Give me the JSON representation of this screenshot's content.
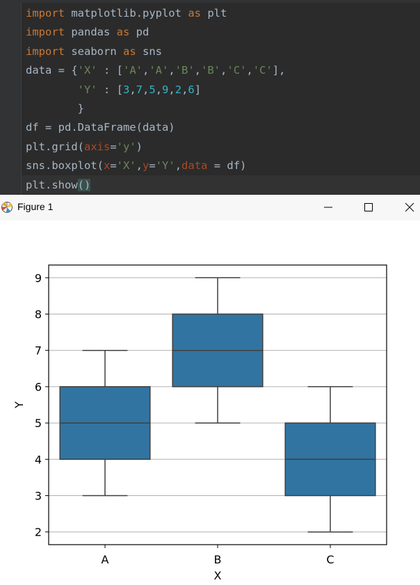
{
  "editor": {
    "lines": [
      [
        {
          "t": "import",
          "c": "kw"
        },
        {
          "t": " matplotlib.pyplot ",
          "c": "plain"
        },
        {
          "t": "as",
          "c": "kw"
        },
        {
          "t": " plt",
          "c": "plain"
        }
      ],
      [
        {
          "t": "import",
          "c": "kw"
        },
        {
          "t": " pandas ",
          "c": "plain"
        },
        {
          "t": "as",
          "c": "kw"
        },
        {
          "t": " pd",
          "c": "plain"
        }
      ],
      [
        {
          "t": "import",
          "c": "kw"
        },
        {
          "t": " seaborn ",
          "c": "plain"
        },
        {
          "t": "as",
          "c": "kw"
        },
        {
          "t": " sns",
          "c": "plain"
        }
      ],
      [
        {
          "t": "data = {",
          "c": "plain"
        },
        {
          "t": "'X'",
          "c": "str"
        },
        {
          "t": " : [",
          "c": "plain"
        },
        {
          "t": "'A'",
          "c": "str"
        },
        {
          "t": ",",
          "c": "plain"
        },
        {
          "t": "'A'",
          "c": "str"
        },
        {
          "t": ",",
          "c": "plain"
        },
        {
          "t": "'B'",
          "c": "str"
        },
        {
          "t": ",",
          "c": "plain"
        },
        {
          "t": "'B'",
          "c": "str"
        },
        {
          "t": ",",
          "c": "plain"
        },
        {
          "t": "'C'",
          "c": "str"
        },
        {
          "t": ",",
          "c": "plain"
        },
        {
          "t": "'C'",
          "c": "str"
        },
        {
          "t": "],",
          "c": "plain"
        }
      ],
      [
        {
          "t": "        ",
          "c": "plain"
        },
        {
          "t": "'Y'",
          "c": "str"
        },
        {
          "t": " : [",
          "c": "plain"
        },
        {
          "t": "3",
          "c": "num"
        },
        {
          "t": ",",
          "c": "plain"
        },
        {
          "t": "7",
          "c": "num"
        },
        {
          "t": ",",
          "c": "plain"
        },
        {
          "t": "5",
          "c": "num"
        },
        {
          "t": ",",
          "c": "plain"
        },
        {
          "t": "9",
          "c": "num"
        },
        {
          "t": ",",
          "c": "plain"
        },
        {
          "t": "2",
          "c": "num"
        },
        {
          "t": ",",
          "c": "plain"
        },
        {
          "t": "6",
          "c": "num"
        },
        {
          "t": "]",
          "c": "plain"
        }
      ],
      [
        {
          "t": "        }",
          "c": "plain"
        }
      ],
      [
        {
          "t": "df = pd.DataFrame(data)",
          "c": "plain"
        }
      ],
      [
        {
          "t": "plt.grid(",
          "c": "plain"
        },
        {
          "t": "axis",
          "c": "kwarg"
        },
        {
          "t": "=",
          "c": "plain"
        },
        {
          "t": "'y'",
          "c": "str"
        },
        {
          "t": ")",
          "c": "plain"
        }
      ],
      [
        {
          "t": "sns.boxplot(",
          "c": "plain"
        },
        {
          "t": "x",
          "c": "kwarg"
        },
        {
          "t": "=",
          "c": "plain"
        },
        {
          "t": "'X'",
          "c": "str"
        },
        {
          "t": ",",
          "c": "plain"
        },
        {
          "t": "y",
          "c": "kwarg"
        },
        {
          "t": "=",
          "c": "plain"
        },
        {
          "t": "'Y'",
          "c": "str"
        },
        {
          "t": ",",
          "c": "plain"
        },
        {
          "t": "data",
          "c": "kwarg"
        },
        {
          "t": " = df)",
          "c": "plain"
        }
      ],
      [
        {
          "t": "plt.show",
          "c": "plain"
        },
        {
          "t": "()",
          "c": "brace-hl"
        }
      ]
    ]
  },
  "window": {
    "title": "Figure 1",
    "minimize_icon": "minimize-icon",
    "maximize_icon": "maximize-icon",
    "close_icon": "close-icon",
    "app_icon": "matplotlib-app-icon"
  },
  "chart_data": {
    "type": "box",
    "categories": [
      "A",
      "B",
      "C"
    ],
    "boxes": [
      {
        "category": "A",
        "min": 3,
        "q1": 4,
        "median": 5,
        "q3": 6,
        "max": 7
      },
      {
        "category": "B",
        "min": 5,
        "q1": 6,
        "median": 7,
        "q3": 8,
        "max": 9
      },
      {
        "category": "C",
        "min": 2,
        "q1": 3,
        "median": 4,
        "q3": 5,
        "max": 6
      }
    ],
    "xlabel": "X",
    "ylabel": "Y",
    "yticks": [
      2,
      3,
      4,
      5,
      6,
      7,
      8,
      9
    ],
    "ylim": [
      1.65,
      9.35
    ],
    "grid": "y",
    "box_color": "#3274a1",
    "line_color": "#3f3f3f",
    "grid_color": "#b0b0b0"
  }
}
